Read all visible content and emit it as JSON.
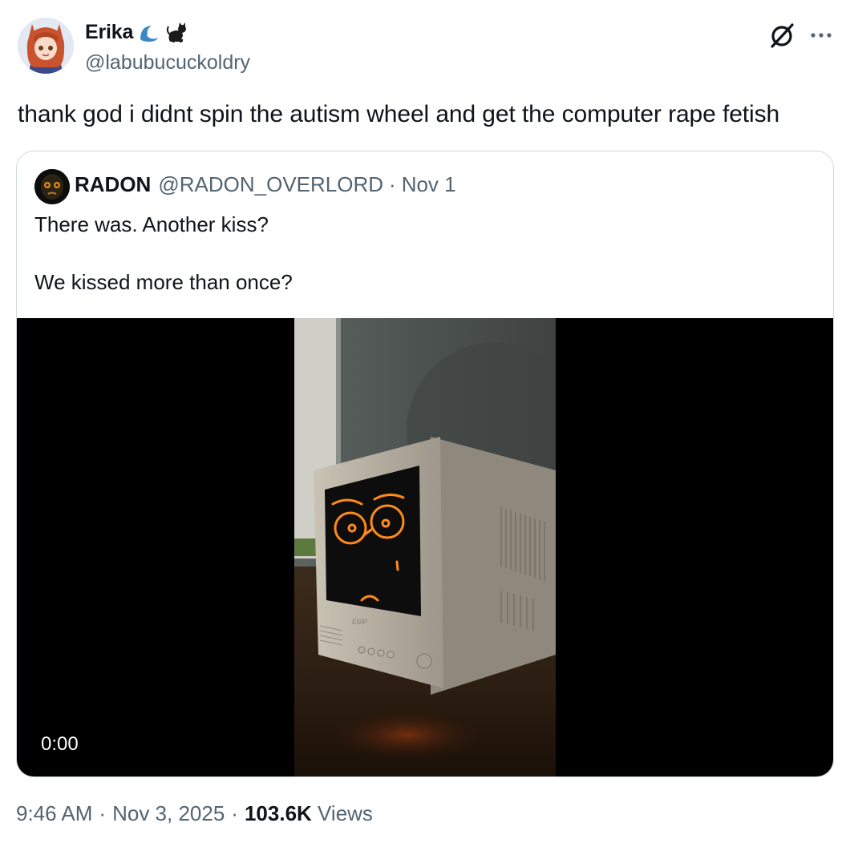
{
  "author": {
    "display_name": "Erika",
    "handle": "@labubucuckoldry",
    "name_emojis": [
      "wave-emoji",
      "black-cat-emoji"
    ]
  },
  "header_icons": [
    "grok-icon",
    "more-icon"
  ],
  "tweet": {
    "text": "thank god i didnt spin the autism wheel and get the computer rape fetish"
  },
  "quote": {
    "display_name": "RADON",
    "handle": "@RADON_OVERLORD",
    "separator": "·",
    "date": "Nov 1",
    "line1": "There was. Another kiss?",
    "line2": "We kissed more than once?",
    "video": {
      "timecode": "0:00"
    }
  },
  "meta": {
    "time": "9:46 AM",
    "sep1": "·",
    "date": "Nov 3, 2025",
    "sep2": "·",
    "views_count": "103.6K",
    "views_label": "Views"
  }
}
